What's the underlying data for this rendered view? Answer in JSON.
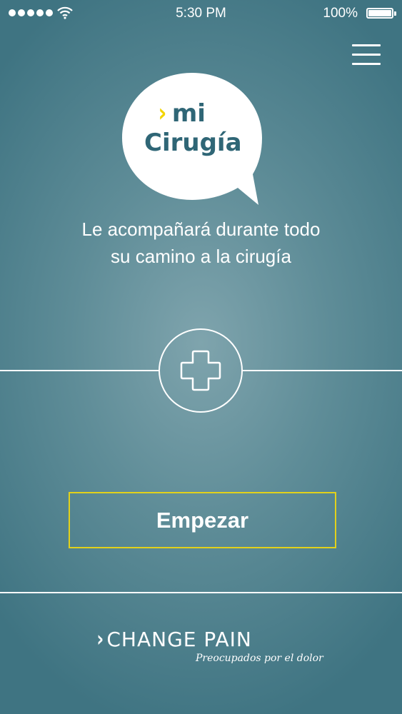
{
  "status_bar": {
    "time": "5:30 PM",
    "battery_percent": "100%",
    "icons": [
      "signal-dots-icon",
      "wifi-icon",
      "battery-icon"
    ]
  },
  "header": {
    "menu_icon": "hamburger-menu-icon"
  },
  "logo": {
    "chevron": "›",
    "line1": "mi",
    "line2": "Cirugía"
  },
  "tagline": {
    "line1": "Le acompañará durante todo",
    "line2": "su camino a la cirugía"
  },
  "divider": {
    "icon": "plus-icon"
  },
  "actions": {
    "start_label": "Empezar"
  },
  "brand": {
    "chevron": "›",
    "name": "CHANGE PAIN",
    "slogan": "Preocupados por el dolor"
  },
  "colors": {
    "background_center": "#7fa4ad",
    "background_edge": "#3f7482",
    "logo_text": "#2f6676",
    "accent_yellow": "#f2d400",
    "button_border": "#e2d11b"
  }
}
